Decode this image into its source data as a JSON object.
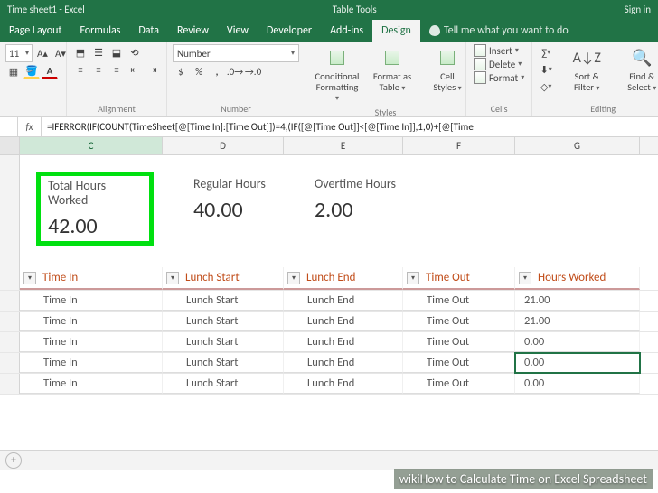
{
  "title": {
    "doc": "Time sheet1",
    "app": "Excel",
    "context_tab_group": "Table Tools",
    "signin": "Sign in"
  },
  "tabs": {
    "page_layout": "Page Layout",
    "formulas": "Formulas",
    "data": "Data",
    "review": "Review",
    "view": "View",
    "developer": "Developer",
    "addins": "Add-ins",
    "design": "Design",
    "tell_me": "Tell me what you want to do"
  },
  "ribbon": {
    "font_size": "11",
    "alignment_label": "Alignment",
    "number_format": "Number",
    "number_label": "Number",
    "cond_fmt_l1": "Conditional",
    "cond_fmt_l2": "Formatting",
    "fmt_table_l1": "Format as",
    "fmt_table_l2": "Table",
    "cell_styles_l1": "Cell",
    "cell_styles_l2": "Styles",
    "styles_label": "Styles",
    "insert": "Insert",
    "delete": "Delete",
    "format": "Format",
    "cells_label": "Cells",
    "sort_filter_l1": "Sort &",
    "sort_filter_l2": "Filter",
    "find_select_l1": "Find &",
    "find_select_l2": "Select",
    "editing_label": "Editing"
  },
  "formula_bar": {
    "fx": "fx",
    "formula": "=IFERROR(IF(COUNT(TimeSheet[@[Time In]:[Time Out]])=4,(IF([@[Time Out]]<[@[Time In]],1,0)+[@[Time"
  },
  "columns": {
    "C": "C",
    "D": "D",
    "E": "E",
    "F": "F",
    "G": "G"
  },
  "summary": {
    "total_label": "Total Hours Worked",
    "total_value": "42.00",
    "regular_label": "Regular Hours",
    "regular_value": "40.00",
    "overtime_label": "Overtime Hours",
    "overtime_value": "2.00"
  },
  "table": {
    "headers": {
      "time_in": "Time In",
      "lunch_start": "Lunch Start",
      "lunch_end": "Lunch End",
      "time_out": "Time Out",
      "hours_worked": "Hours Worked"
    },
    "rows": [
      {
        "time_in": "Time In",
        "lunch_start": "Lunch Start",
        "lunch_end": "Lunch End",
        "time_out": "Time Out",
        "hours": "21.00"
      },
      {
        "time_in": "Time In",
        "lunch_start": "Lunch Start",
        "lunch_end": "Lunch End",
        "time_out": "Time Out",
        "hours": "21.00"
      },
      {
        "time_in": "Time In",
        "lunch_start": "Lunch Start",
        "lunch_end": "Lunch End",
        "time_out": "Time Out",
        "hours": "0.00"
      },
      {
        "time_in": "Time In",
        "lunch_start": "Lunch Start",
        "lunch_end": "Lunch End",
        "time_out": "Time Out",
        "hours": "0.00"
      },
      {
        "time_in": "Time In",
        "lunch_start": "Lunch Start",
        "lunch_end": "Lunch End",
        "time_out": "Time Out",
        "hours": "0.00"
      }
    ]
  },
  "watermark": {
    "brand1": "wiki",
    "brand2": "How to ",
    "title": "Calculate Time on Excel Spreadsheet"
  }
}
